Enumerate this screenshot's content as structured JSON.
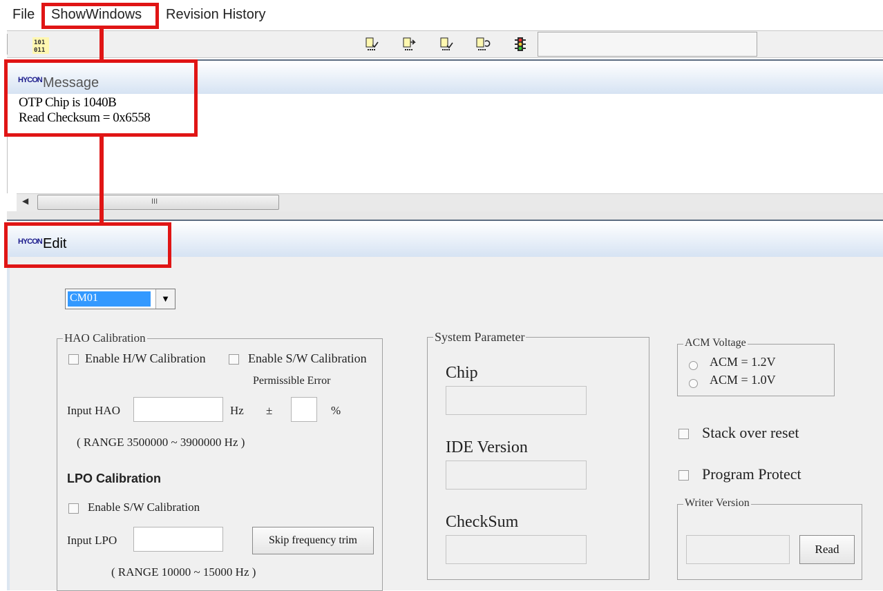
{
  "menu": {
    "file": "File",
    "show_windows": "ShowWindows",
    "revision_history": "Revision History"
  },
  "toolbar": {
    "binary_icon_text_top": "101",
    "binary_icon_text_bottom": "011",
    "icons": [
      "check-page-icon",
      "copy-page-icon",
      "verify-page-icon",
      "reload-page-icon",
      "traffic-light-icon"
    ]
  },
  "message_panel": {
    "logo": "HYCON",
    "title": "Message",
    "lines": [
      "OTP Chip is 1040B",
      "Read Checksum = 0x6558"
    ],
    "scroll_thumb_grip": "III"
  },
  "edit_panel": {
    "logo": "HYCON",
    "title": "Edit",
    "dropdown_value": "CM01",
    "hao": {
      "legend": "HAO Calibration",
      "enable_hw": "Enable H/W Calibration",
      "enable_sw": "Enable S/W Calibration",
      "permissible_error": "Permissible Error",
      "input_label": "Input HAO",
      "hz_unit": "Hz",
      "plus_minus": "±",
      "percent": "%",
      "range_text": "( RANGE  3500000  ~    3900000    Hz )"
    },
    "lpo": {
      "title": "LPO Calibration",
      "enable_sw": "Enable S/W Calibration",
      "input_label": "Input LPO",
      "skip_button": "Skip frequency trim",
      "range_text": "( RANGE 10000 ~   15000  Hz )"
    },
    "system": {
      "legend": "System Parameter",
      "chip_label": "Chip",
      "ide_label": "IDE Version",
      "checksum_label": "CheckSum"
    },
    "acm": {
      "legend": "ACM Voltage",
      "option_1": "ACM = 1.2V",
      "option_2": "ACM = 1.0V"
    },
    "stack_over_reset": "Stack over reset",
    "program_protect": "Program Protect",
    "writer": {
      "legend": "Writer Version",
      "read_button": "Read"
    }
  },
  "colors": {
    "annotation_red": "#e01515",
    "header_gradient_bottom": "#d6e3f3",
    "dropdown_selected": "#3399ff"
  }
}
